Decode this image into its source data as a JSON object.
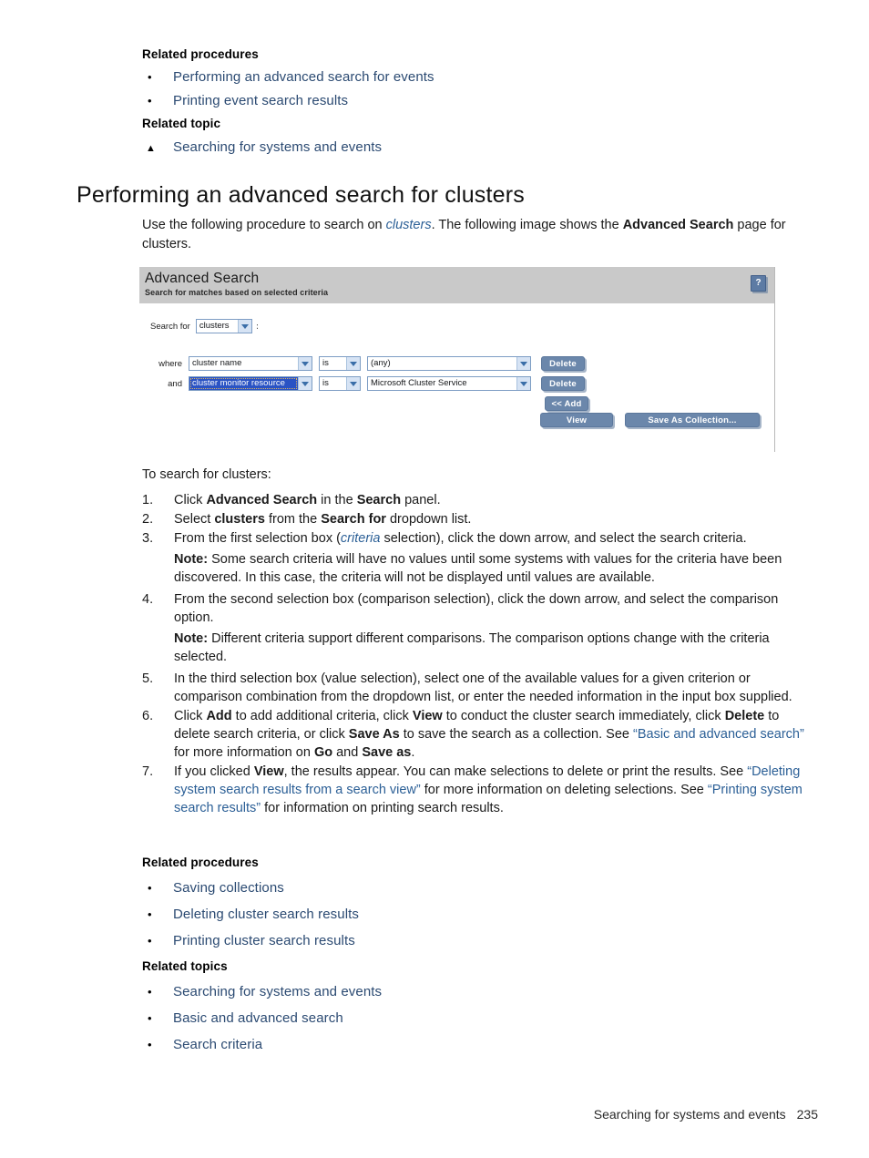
{
  "top_related": {
    "procedures_heading": "Related procedures",
    "procedures": [
      "Performing an advanced search for events",
      "Printing event search results"
    ],
    "topic_heading": "Related topic",
    "topics": [
      "Searching for systems and events"
    ]
  },
  "section": {
    "title": "Performing an advanced search for clusters",
    "intro_1": "Use the following procedure to search on ",
    "intro_italic": "clusters",
    "intro_2": ". The following image shows the ",
    "intro_bold": "Advanced Search",
    "intro_3": " page for clusters."
  },
  "app_screenshot": {
    "title": "Advanced Search",
    "subtitle": "Search for matches based on selected criteria",
    "help_icon_label": "?",
    "search_for_label": "Search for",
    "search_for_value": "clusters",
    "colon": ":",
    "criteria_rows": [
      {
        "conjunction": "where",
        "criteria": "cluster name",
        "comparison": "is",
        "value": "(any)",
        "delete_label": "Delete",
        "selected": false
      },
      {
        "conjunction": "and",
        "criteria": "cluster monitor resource",
        "comparison": "is",
        "value": "Microsoft Cluster Service",
        "delete_label": "Delete",
        "selected": true
      }
    ],
    "add_label": "<< Add",
    "view_label": "View",
    "save_label": "Save As Collection..."
  },
  "procedure": {
    "intro": "To search for clusters:",
    "steps": [
      {
        "num": "1.",
        "html": "Click <b>Advanced Search</b> in the <b>Search</b> panel."
      },
      {
        "num": "2.",
        "html": "Select <b>clusters</b> from the <b>Search for</b> dropdown list."
      },
      {
        "num": "3.",
        "html": "From the first selection box (<i>criteria</i> selection), click the down arrow, and select the search criteria.",
        "note": "<b>Note:</b> Some search criteria will have no values until some systems with values for the criteria have been discovered. In this case, the criteria will not be displayed until values are available."
      },
      {
        "num": "4.",
        "html": "From the second selection box (comparison selection), click the down arrow, and select the comparison option.",
        "note": "<b>Note:</b> Different criteria support different comparisons. The comparison options change with the criteria selected."
      },
      {
        "num": "5.",
        "html": "In the third selection box (value selection), select one of the available values for a given criterion or comparison combination from the dropdown list, or enter the needed information in the input box supplied."
      },
      {
        "num": "6.",
        "html": "Click <b>Add</b> to add additional criteria, click <b>View</b> to conduct the cluster search immediately, click <b>Delete</b> to delete search criteria, or click <b>Save As</b> to save the search as a collection. See <span class=\"blue-link\">&ldquo;Basic and advanced search&rdquo;</span> for more information on <b>Go</b> and <b>Save as</b>."
      },
      {
        "num": "7.",
        "html": "If you clicked <b>View</b>, the results appear. You can make selections to delete or print the results. See <span class=\"blue-link\">&ldquo;Deleting system search results from a search view&rdquo;</span> for more information on deleting selections. See <span class=\"blue-link\">&ldquo;Printing system search results&rdquo;</span> for information on printing search results."
      }
    ]
  },
  "bottom_related": {
    "procedures_heading": "Related procedures",
    "procedures": [
      "Saving collections",
      "Deleting cluster search results",
      "Printing cluster search results"
    ],
    "topics_heading": "Related topics",
    "topics": [
      "Searching for systems and events",
      "Basic and advanced search",
      "Search criteria"
    ]
  },
  "footer": {
    "chapter": "Searching for systems and events",
    "page_number": "235"
  },
  "colors": {
    "link": "#2b4a72",
    "cross_ref": "#2b5f96",
    "app_header_bg": "#c9c9c9",
    "button_bg": "#6b87ab",
    "select_border": "#7d9dc4",
    "selection_highlight": "#2a53c4"
  }
}
